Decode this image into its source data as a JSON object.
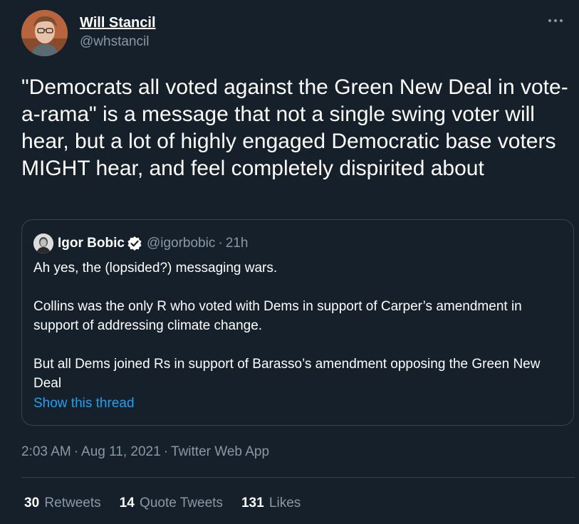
{
  "author": {
    "display_name": "Will Stancil",
    "handle": "@whstancil"
  },
  "tweet": {
    "text": "\"Democrats all voted against the Green New Deal in vote-a-rama\" is a message that not a single swing voter will hear, but a lot of highly engaged Democratic base voters MIGHT hear, and feel completely dispirited about"
  },
  "quote": {
    "name": "Igor Bobic",
    "handle": "@igorbobic",
    "dot": "·",
    "time": "21h",
    "paragraphs": [
      "Ah yes, the (lopsided?) messaging wars.",
      "Collins was the only R who voted with Dems in support of Carper’s amendment in support of addressing climate change.",
      "But all Dems joined Rs in support of Barasso’s amendment opposing the Green New Deal"
    ],
    "show_thread": "Show this thread"
  },
  "meta": {
    "time": "2:03 AM",
    "sep1": "·",
    "date": "Aug 11, 2021",
    "sep2": "·",
    "app": "Twitter Web App"
  },
  "stats": {
    "retweets_count": "30",
    "retweets_label": "Retweets",
    "quotes_count": "14",
    "quotes_label": "Quote Tweets",
    "likes_count": "131",
    "likes_label": "Likes"
  },
  "icons": {
    "more": "more-horizontal-icon",
    "verified": "verified-badge-icon"
  },
  "colors": {
    "background": "#15202b",
    "secondary_text": "#8899a6",
    "link": "#1da1f2",
    "border": "#38444d"
  }
}
